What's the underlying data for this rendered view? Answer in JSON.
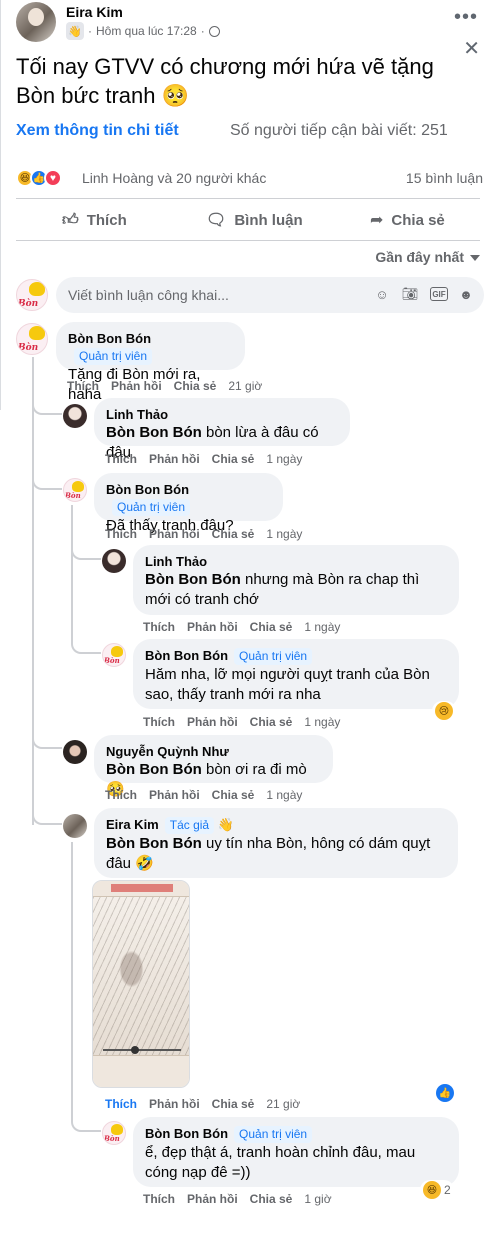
{
  "post": {
    "author": "Eira Kim",
    "time": "Hôm qua lúc 17:28",
    "dot": "·",
    "text": "Tối nay GTVV có chương mới hứa vẽ tặng Bòn bức tranh 🥺",
    "see_details": "Xem thông tin chi tiết",
    "reach": "Số người tiếp cận bài viết: 251",
    "reaction_text": "Linh Hoàng và 20 người khác",
    "comment_count": "15 bình luận",
    "actions": {
      "like": "Thích",
      "comment": "Bình luận",
      "share": "Chia sẻ"
    },
    "sort": "Gần đây nhất",
    "input_placeholder": "Viết bình luận công khai...",
    "reaction_glyphs": {
      "haha": "😆",
      "like": "👍",
      "love": "♥"
    }
  },
  "labels": {
    "like": "Thích",
    "reply": "Phản hồi",
    "share": "Chia sẻ",
    "admin": "Quản trị viên",
    "author": "Tác giả"
  },
  "comments": {
    "c1": {
      "name": "Bòn Bon Bón",
      "text": "Tặng đi Bòn mới ra, haha",
      "time": "21 giờ"
    },
    "c2": {
      "name": "Linh Thảo",
      "mention": "Bòn Bon Bón",
      "text": " bòn lừa à đâu có đâu",
      "time": "1 ngày"
    },
    "c3": {
      "name": "Bòn Bon Bón",
      "text": "Đã thấy tranh đâu?",
      "time": "1 ngày"
    },
    "c4": {
      "name": "Linh Thảo",
      "mention": "Bòn Bon Bón",
      "text": " nhưng mà Bòn ra chap thì mới có tranh chớ",
      "time": "1 ngày"
    },
    "c5": {
      "name": "Bòn Bon Bón",
      "text": "Hăm nha, lỡ mọi người quỵt tranh của Bòn sao, thấy tranh mới ra nha",
      "time": "1 ngày",
      "reaction": "😢"
    },
    "c6": {
      "name": "Nguyễn Quỳnh Như",
      "mention": "Bòn Bon Bón",
      "text": " bòn ơi ra đi mò 🥺",
      "time": "1 ngày"
    },
    "c7": {
      "name": "Eira Kim",
      "mention": "Bòn Bon Bón",
      "text": " uy tín nha Bòn, hông có dám quỵt đâu 🤣",
      "time": "21 giờ",
      "reaction": "👍"
    },
    "c8": {
      "name": "Bòn Bon Bón",
      "text": "ể, đẹp thật á, tranh hoàn chỉnh đâu, mau cóng nạp đê =))",
      "time": "1 giờ",
      "reaction": "😆",
      "reaction_count": "2"
    }
  },
  "icons": [
    "more-icon",
    "close-icon",
    "globe-icon",
    "like-icon",
    "comment-icon",
    "share-icon",
    "emoji-icon",
    "camera-icon",
    "gif-icon",
    "sticker-icon"
  ]
}
